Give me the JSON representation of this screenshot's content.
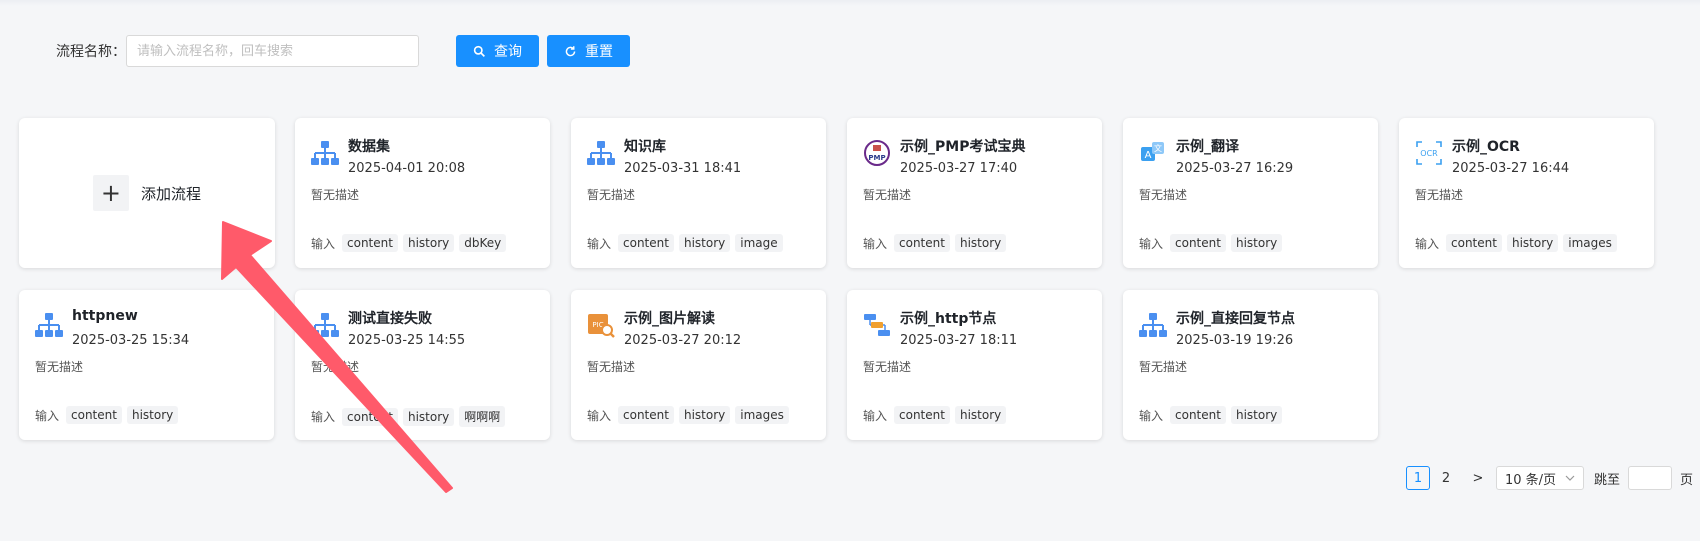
{
  "search": {
    "label": "流程名称：",
    "placeholder": "请输入流程名称，回车搜索",
    "query_label": "查询",
    "reset_label": "重置"
  },
  "add_card": {
    "label": "添加流程"
  },
  "cards": [
    {
      "title": "数据集",
      "date": "2025-04-01 20:08",
      "desc": "暂无描述",
      "inputs_label": "输入",
      "tags": [
        "content",
        "history",
        "dbKey"
      ],
      "icon": "workflow-tree-icon"
    },
    {
      "title": "知识库",
      "date": "2025-03-31 18:41",
      "desc": "暂无描述",
      "inputs_label": "输入",
      "tags": [
        "content",
        "history",
        "image"
      ],
      "icon": "workflow-tree-icon"
    },
    {
      "title": "示例_PMP考试宝典",
      "date": "2025-03-27 17:40",
      "desc": "暂无描述",
      "inputs_label": "输入",
      "tags": [
        "content",
        "history"
      ],
      "icon": "pmp-icon"
    },
    {
      "title": "示例_翻译",
      "date": "2025-03-27 16:29",
      "desc": "暂无描述",
      "inputs_label": "输入",
      "tags": [
        "content",
        "history"
      ],
      "icon": "translate-icon"
    },
    {
      "title": "示例_OCR",
      "date": "2025-03-27 16:44",
      "desc": "暂无描述",
      "inputs_label": "输入",
      "tags": [
        "content",
        "history",
        "images"
      ],
      "icon": "ocr-icon"
    },
    {
      "title": "httpnew",
      "date": "2025-03-25 15:34",
      "desc": "暂无描述",
      "inputs_label": "输入",
      "tags": [
        "content",
        "history"
      ],
      "icon": "workflow-tree-icon"
    },
    {
      "title": "测试直接失败",
      "date": "2025-03-25 14:55",
      "desc": "暂无描述",
      "inputs_label": "输入",
      "tags": [
        "content",
        "history",
        "啊啊啊"
      ],
      "icon": "workflow-tree-icon"
    },
    {
      "title": "示例_图片解读",
      "date": "2025-03-27 20:12",
      "desc": "暂无描述",
      "inputs_label": "输入",
      "tags": [
        "content",
        "history",
        "images"
      ],
      "icon": "image-analysis-icon"
    },
    {
      "title": "示例_http节点",
      "date": "2025-03-27 18:11",
      "desc": "暂无描述",
      "inputs_label": "输入",
      "tags": [
        "content",
        "history"
      ],
      "icon": "http-node-icon"
    },
    {
      "title": "示例_直接回复节点",
      "date": "2025-03-19 19:26",
      "desc": "暂无描述",
      "inputs_label": "输入",
      "tags": [
        "content",
        "history"
      ],
      "icon": "workflow-tree-icon"
    }
  ],
  "pagination": {
    "current": "1",
    "page2": "2",
    "next": ">",
    "page_size": "10 条/页",
    "jump_label": "跳至",
    "suffix": "页"
  },
  "colors": {
    "primary": "#1890ff",
    "arrow": "#ff5a6a"
  }
}
